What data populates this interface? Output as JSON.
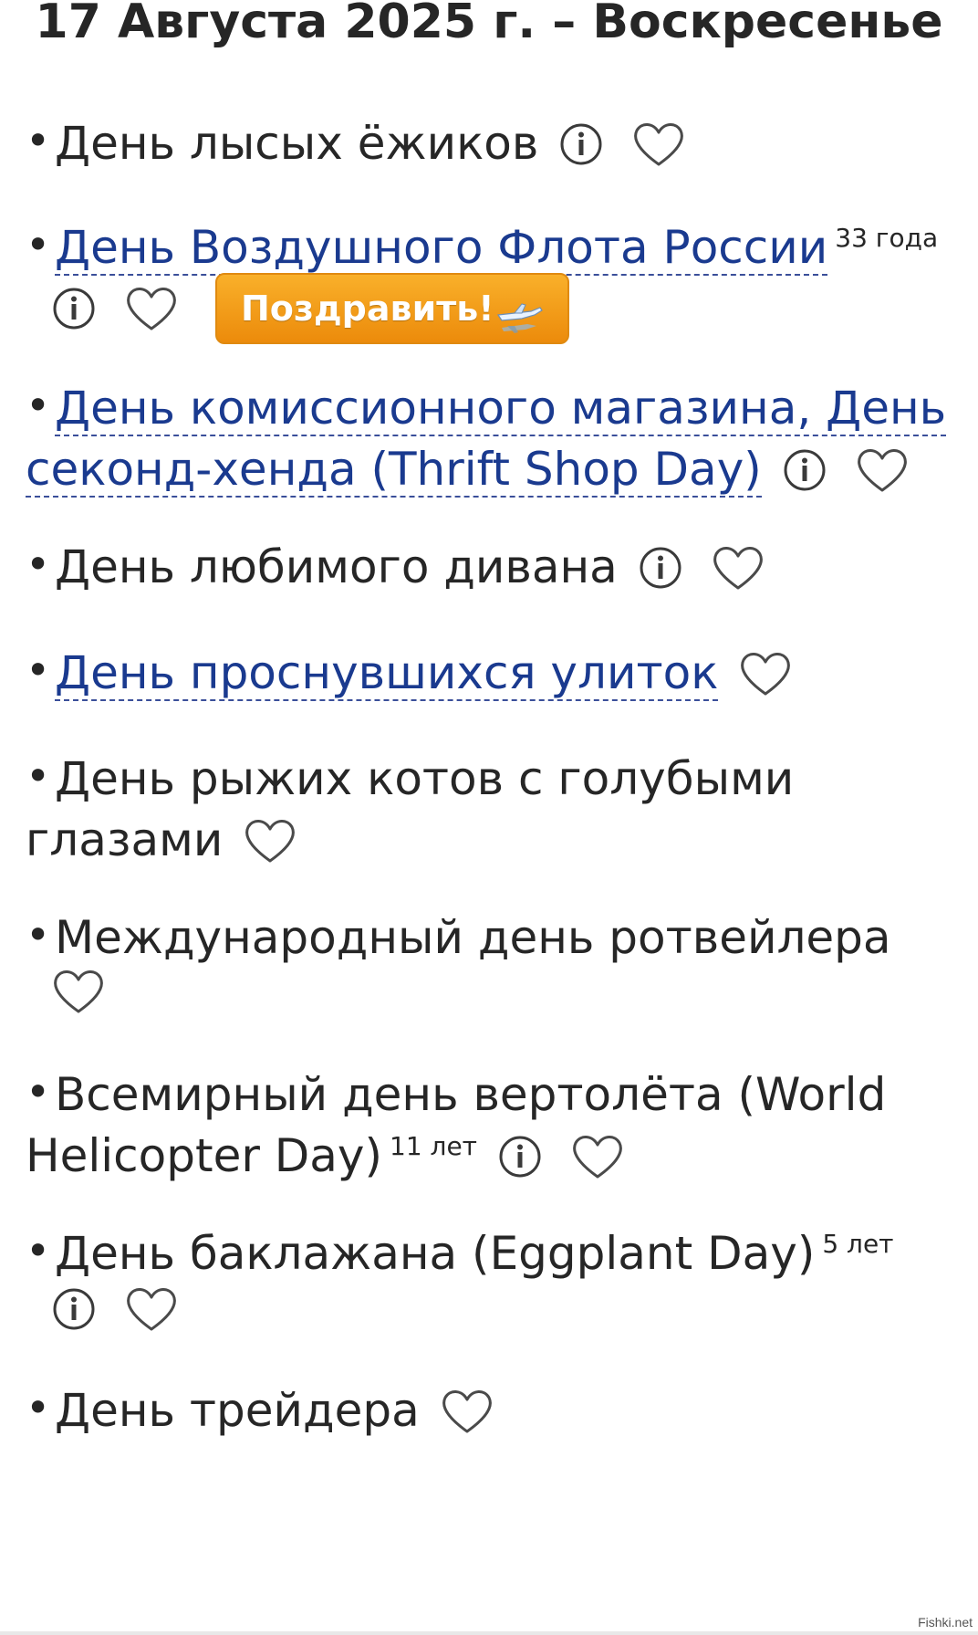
{
  "header": {
    "title": "17 Августа 2025 г. – Воскресенье"
  },
  "bullet": "•",
  "items": [
    {
      "text": "День лысых ёжиков",
      "link": false,
      "years": "",
      "info": true,
      "favorite": true
    },
    {
      "text": "День Воздушного Флота России",
      "link": true,
      "years": "33 года",
      "info": true,
      "favorite": true,
      "button": "Поздравить!"
    },
    {
      "text": "День комиссионного магазина, День секонд-хенда (Thrift Shop Day)",
      "link": true,
      "years": "",
      "info": true,
      "favorite": true
    },
    {
      "text": "День любимого дивана",
      "link": false,
      "years": "",
      "info": true,
      "favorite": true
    },
    {
      "text": "День проснувшихся улиток",
      "link": true,
      "years": "",
      "info": false,
      "favorite": true
    },
    {
      "text": "День рыжих котов с голубыми глазами",
      "link": false,
      "years": "",
      "info": false,
      "favorite": true
    },
    {
      "text": "Международный день ротвейлера",
      "link": false,
      "years": "",
      "info": false,
      "favorite": true
    },
    {
      "text": "Всемирный день вертолёта (World Helicopter Day)",
      "link": false,
      "years": "11 лет",
      "info": true,
      "favorite": true
    },
    {
      "text": "День баклажана (Eggplant Day)",
      "link": false,
      "years": "5 лет",
      "info": true,
      "favorite": true
    },
    {
      "text": "День трейдера",
      "link": false,
      "years": "",
      "info": false,
      "favorite": true
    }
  ],
  "icons": {
    "info": "info-icon",
    "favorite": "heart-icon",
    "button_decoration": "airplane-icon"
  },
  "colors": {
    "link": "#1a3a8f",
    "text": "#262626",
    "button_top": "#f9b02a",
    "button_bottom": "#ec8b0b"
  },
  "watermark": "Fishki.net"
}
